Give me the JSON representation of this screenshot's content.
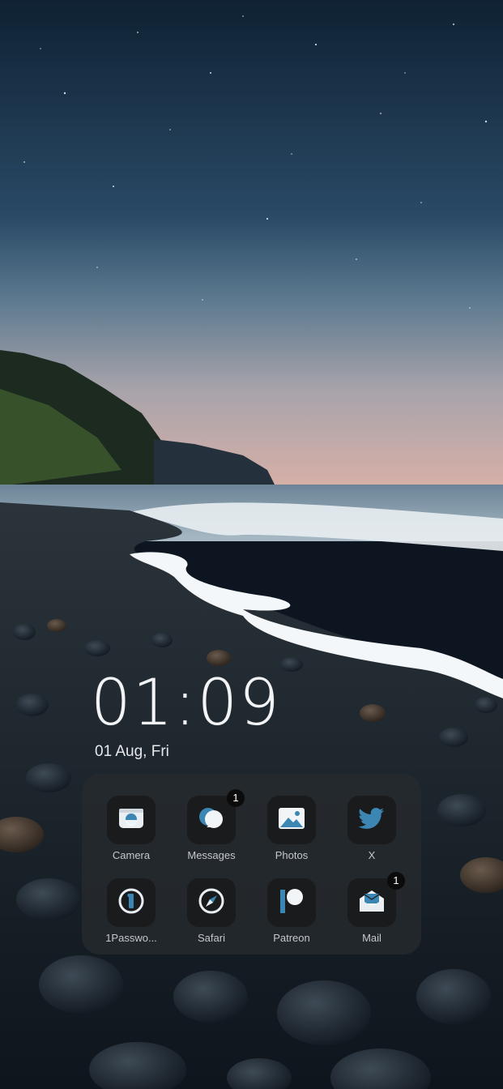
{
  "lockscreen": {
    "time": "01:09",
    "date": "01 Aug, Fri"
  },
  "colors": {
    "icon_accent": "#3c86b4",
    "icon_tile": "#1a1b1d",
    "folder_bg": "#262a2e"
  },
  "folder": {
    "apps": [
      {
        "label": "Camera",
        "icon": "camera-icon",
        "badge": ""
      },
      {
        "label": "Messages",
        "icon": "messages-icon",
        "badge": "1"
      },
      {
        "label": "Photos",
        "icon": "photos-icon",
        "badge": ""
      },
      {
        "label": "X",
        "icon": "twitter-bird-icon",
        "badge": ""
      },
      {
        "label": "1Passwo...",
        "icon": "onepassword-icon",
        "badge": ""
      },
      {
        "label": "Safari",
        "icon": "compass-icon",
        "badge": ""
      },
      {
        "label": "Patreon",
        "icon": "patreon-icon",
        "badge": ""
      },
      {
        "label": "Mail",
        "icon": "mail-icon",
        "badge": "1"
      }
    ]
  }
}
